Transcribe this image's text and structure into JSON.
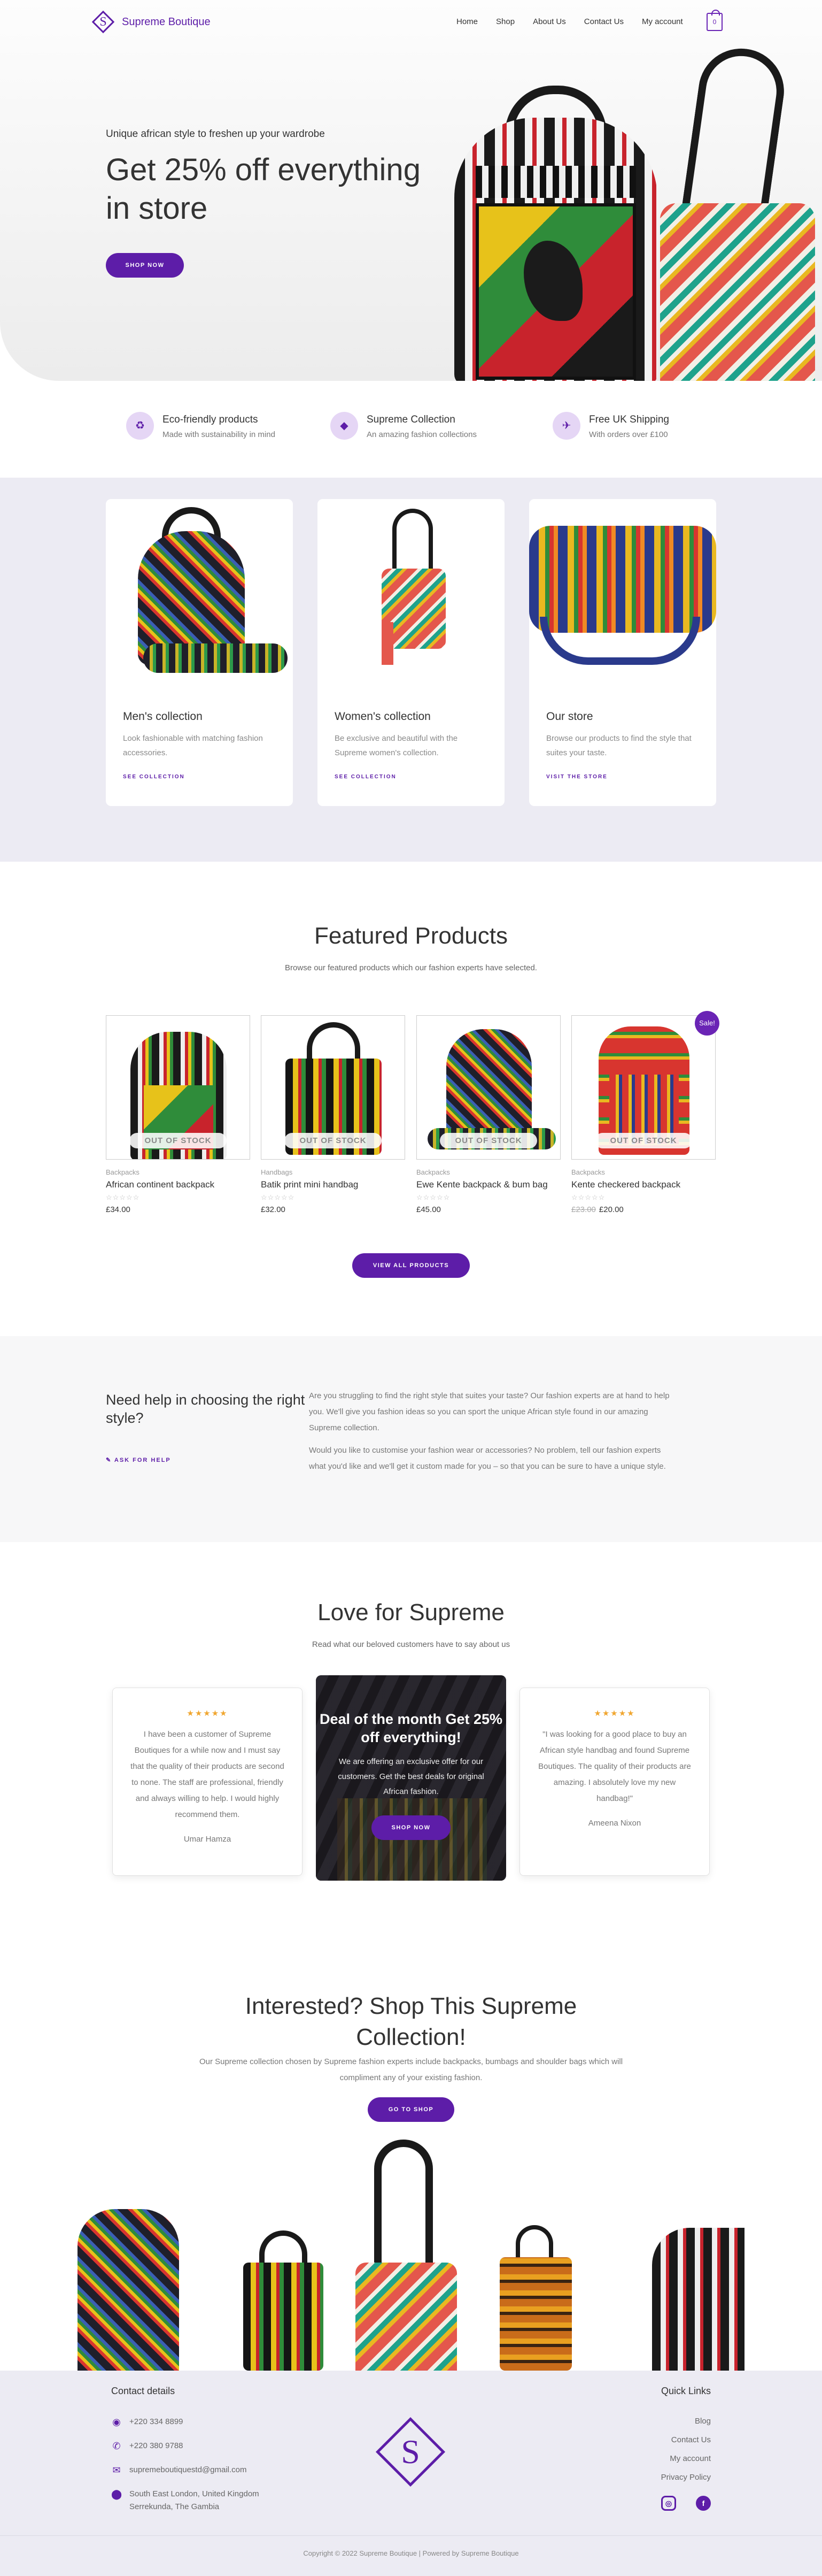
{
  "header": {
    "brand": "Supreme Boutique",
    "nav": [
      "Home",
      "Shop",
      "About Us",
      "Contact Us",
      "My account"
    ],
    "cart_count": "0"
  },
  "hero": {
    "subtitle": "Unique african style to freshen up your wardrobe",
    "title": "Get 25% off everything in store",
    "button": "SHOP NOW"
  },
  "features": [
    {
      "icon": "recycle-icon",
      "title": "Eco-friendly products",
      "desc": "Made with sustainability in mind"
    },
    {
      "icon": "diamond-icon",
      "title": "Supreme Collection",
      "desc": "An amazing fashion collections"
    },
    {
      "icon": "plane-icon",
      "title": "Free UK Shipping",
      "desc": "With orders over £100"
    }
  ],
  "collections": [
    {
      "title": "Men's collection",
      "desc": "Look fashionable with matching fashion accessories.",
      "link": "SEE COLLECTION"
    },
    {
      "title": "Women's collection",
      "desc": "Be exclusive and beautiful with the Supreme women's collection.",
      "link": "SEE COLLECTION"
    },
    {
      "title": "Our store",
      "desc": "Browse our products to find the style that suites your taste.",
      "link": "VISIT THE STORE"
    }
  ],
  "featured": {
    "title": "Featured Products",
    "subtitle": "Browse our featured products which our fashion experts have selected.",
    "out_of_stock": "OUT OF STOCK",
    "sale_badge": "Sale!",
    "products": [
      {
        "category": "Backpacks",
        "name": "African continent backpack",
        "rating": "☆☆☆☆☆",
        "old_price": "",
        "price": "£34.00"
      },
      {
        "category": "Handbags",
        "name": "Batik print mini handbag",
        "rating": "☆☆☆☆☆",
        "old_price": "",
        "price": "£32.00"
      },
      {
        "category": "Backpacks",
        "name": "Ewe Kente backpack & bum bag",
        "rating": "☆☆☆☆☆",
        "old_price": "",
        "price": "£45.00"
      },
      {
        "category": "Backpacks",
        "name": "Kente checkered backpack",
        "rating": "☆☆☆☆☆",
        "old_price": "£23.00",
        "price": "£20.00"
      }
    ],
    "view_all": "VIEW ALL PRODUCTS"
  },
  "help": {
    "title": "Need help in choosing the right style?",
    "link": "ASK FOR HELP",
    "p1": "Are you struggling to find the right style that suites your taste? Our fashion experts are at hand to help you. We'll give you fashion ideas so you can sport the unique African style found in our amazing Supreme collection.",
    "p2": "Would you like to customise your fashion wear or accessories? No problem, tell our fashion experts what you'd like and we'll get it custom made for you – so that you can be sure to have a unique style."
  },
  "testimonials": {
    "title": "Love for Supreme",
    "subtitle": "Read what our beloved customers have to say about us",
    "stars": "★★★★★",
    "items": [
      {
        "quote": "I have been a customer of Supreme Boutiques for a while now and I must say that the quality of their products are second to none. The staff are professional, friendly and always willing to help. I would highly recommend them.",
        "name": "Umar Hamza"
      },
      {
        "quote": "\"I was looking for a good place to buy an African style handbag and found Supreme Boutiques. The quality of their products are amazing. I absolutely love my new handbag!\"",
        "name": "Ameena Nixon"
      }
    ],
    "deal": {
      "title": "Deal of the month Get 25% off everything!",
      "text": "We are offering an exclusive offer for our customers. Get the best deals for original African fashion.",
      "button": "SHOP NOW"
    }
  },
  "interested": {
    "title": "Interested? Shop This Supreme Collection!",
    "subtitle": "Our Supreme collection chosen by Supreme fashion experts include backpacks, bumbags and shoulder bags which will compliment any of your existing fashion.",
    "button": "GO TO SHOP"
  },
  "footer": {
    "contact_title": "Contact details",
    "contacts": [
      {
        "icon": "whatsapp-icon",
        "text": "+220 334 8899"
      },
      {
        "icon": "phone-icon",
        "text": "+220 380 9788"
      },
      {
        "icon": "mail-icon",
        "text": "supremeboutiquestd@gmail.com"
      },
      {
        "icon": "location-icon",
        "text": "South East London, United Kingdom Serrekunda, The Gambia"
      }
    ],
    "links_title": "Quick Links",
    "links": [
      "Blog",
      "Contact Us",
      "My account",
      "Privacy Policy"
    ],
    "copyright": "Copyright © 2022 Supreme Boutique | Powered by Supreme Boutique"
  },
  "colors": {
    "accent": "#5d1da8",
    "accent_light": "#e5d6f5",
    "section_bg": "#ecebf3"
  }
}
